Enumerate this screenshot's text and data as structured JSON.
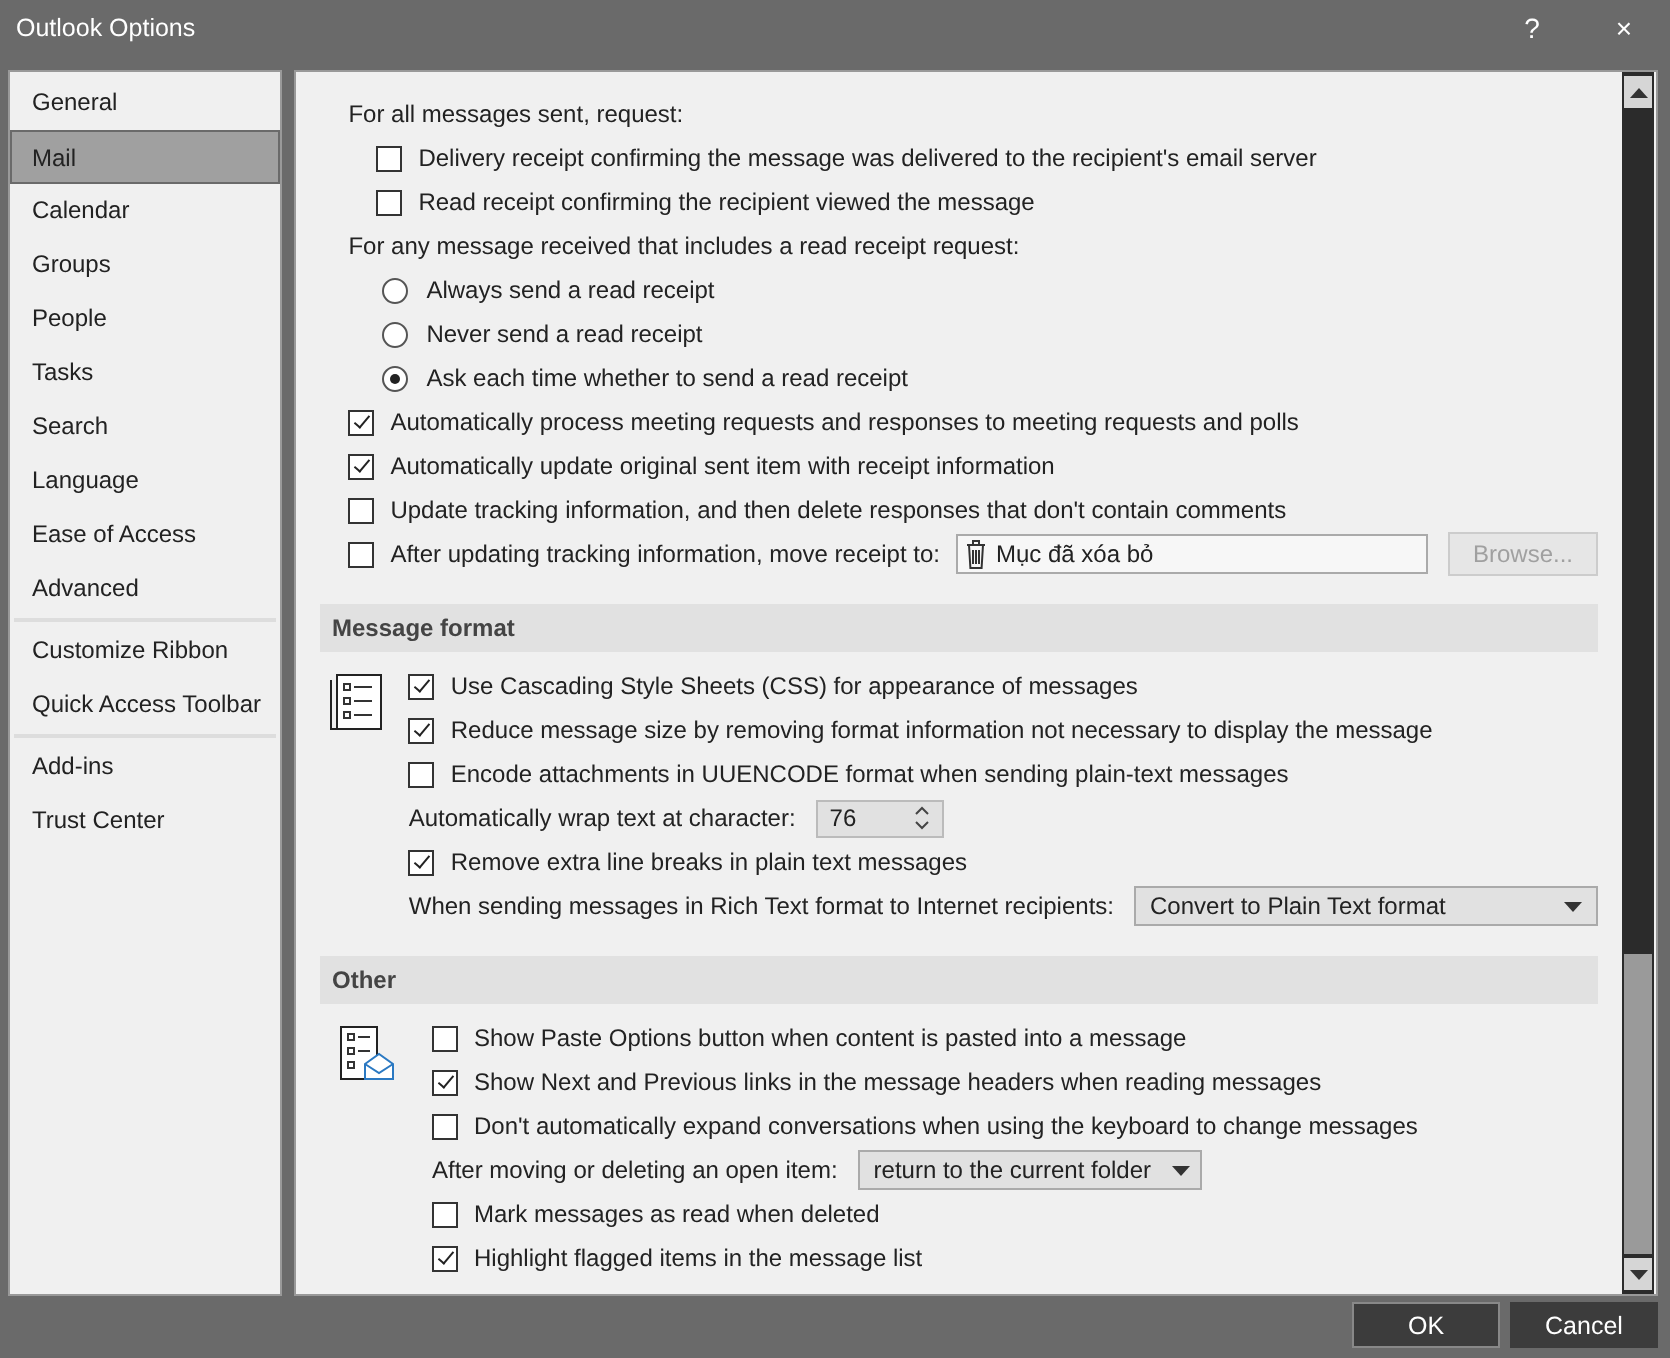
{
  "window": {
    "title": "Outlook Options",
    "help": "?",
    "close": "×"
  },
  "sidebar": {
    "groups": [
      [
        {
          "label": "General",
          "selected": false
        },
        {
          "label": "Mail",
          "selected": true
        },
        {
          "label": "Calendar",
          "selected": false
        },
        {
          "label": "Groups",
          "selected": false
        },
        {
          "label": "People",
          "selected": false
        },
        {
          "label": "Tasks",
          "selected": false
        },
        {
          "label": "Search",
          "selected": false
        },
        {
          "label": "Language",
          "selected": false
        },
        {
          "label": "Ease of Access",
          "selected": false
        },
        {
          "label": "Advanced",
          "selected": false
        }
      ],
      [
        {
          "label": "Customize Ribbon",
          "selected": false
        },
        {
          "label": "Quick Access Toolbar",
          "selected": false
        }
      ],
      [
        {
          "label": "Add-ins",
          "selected": false
        },
        {
          "label": "Trust Center",
          "selected": false
        }
      ]
    ]
  },
  "sections": [
    {
      "items": [
        {
          "kind": "label",
          "text": "For all messages sent, request:",
          "children": [
            {
              "kind": "checkbox",
              "text": "Delivery receipt confirming the message was delivered to the recipient's email server",
              "checked": false
            },
            {
              "kind": "checkbox",
              "text": "Read receipt confirming the recipient viewed the message",
              "checked": false
            }
          ]
        },
        {
          "kind": "label",
          "text": "For any message received that includes a read receipt request:",
          "children": [
            {
              "kind": "radio",
              "text": "Always send a read receipt",
              "selected": false
            },
            {
              "kind": "radio",
              "text": "Never send a read receipt",
              "selected": false
            },
            {
              "kind": "radio",
              "text": "Ask each time whether to send a read receipt",
              "selected": true
            }
          ]
        },
        {
          "kind": "checkbox",
          "text": "Automatically process meeting requests and responses to meeting requests and polls",
          "checked": true
        },
        {
          "kind": "checkbox",
          "text": "Automatically update original sent item with receipt information",
          "checked": true
        },
        {
          "kind": "checkbox",
          "text": "Update tracking information, and then delete responses that don't contain comments",
          "checked": false
        },
        {
          "kind": "checkbox_folder",
          "text": "After updating tracking information, move receipt to:",
          "checked": false,
          "value": "Mục đã xóa bỏ",
          "button": "Browse...",
          "button_disabled": true
        }
      ]
    },
    {
      "title": "Message format",
      "items": [
        {
          "kind": "checkbox",
          "text": "Use Cascading Style Sheets (CSS) for appearance of messages",
          "checked": true
        },
        {
          "kind": "checkbox",
          "text": "Reduce message size by removing format information not necessary to display the message",
          "checked": true
        },
        {
          "kind": "checkbox",
          "text": "Encode attachments in UUENCODE format when sending plain-text messages",
          "checked": false
        },
        {
          "kind": "spinner",
          "text": "Automatically wrap text at character:",
          "value": "76"
        },
        {
          "kind": "checkbox",
          "text": "Remove extra line breaks in plain text messages",
          "checked": true
        },
        {
          "kind": "dropdown",
          "text": "When sending messages in Rich Text format to Internet recipients:",
          "value": "Convert to Plain Text format"
        }
      ]
    },
    {
      "title": "Other",
      "items": [
        {
          "kind": "checkbox",
          "text": "Show Paste Options button when content is pasted into a message",
          "checked": false
        },
        {
          "kind": "checkbox",
          "text": "Show Next and Previous links in the message headers when reading messages",
          "checked": true
        },
        {
          "kind": "checkbox",
          "text": "Don't automatically expand conversations when using the keyboard to change messages",
          "checked": false
        },
        {
          "kind": "dropdown",
          "text": "After moving or deleting an open item:",
          "value": "return to the current folder"
        },
        {
          "kind": "checkbox",
          "text": "Mark messages as read when deleted",
          "checked": false
        },
        {
          "kind": "checkbox",
          "text": "Highlight flagged items in the message list",
          "checked": true
        }
      ]
    }
  ],
  "buttons": [
    {
      "label": "OK",
      "default": true
    },
    {
      "label": "Cancel",
      "default": false
    }
  ]
}
